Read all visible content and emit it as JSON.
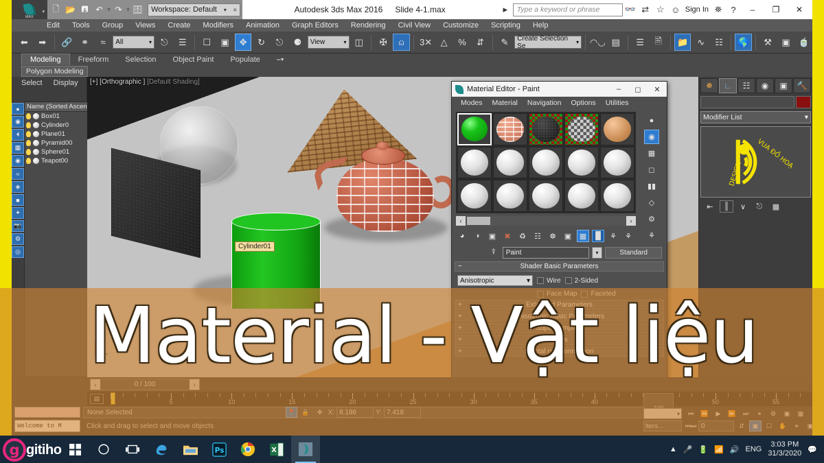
{
  "window": {
    "title": "Autodesk 3ds Max 2016",
    "file": "Slide 4-1.max",
    "workspace": "Workspace: Default",
    "search_placeholder": "Type a keyword or phrase",
    "sign_in": "Sign In",
    "minimize": "–",
    "maximize": "❐",
    "close": "✕",
    "help": "?"
  },
  "menubar": {
    "items": [
      "Edit",
      "Tools",
      "Group",
      "Views",
      "Create",
      "Modifiers",
      "Animation",
      "Graph Editors",
      "Rendering",
      "Civil View",
      "Customize",
      "Scripting",
      "Help"
    ]
  },
  "main_toolbar": {
    "selection_filter": "All",
    "reference_coord": "View",
    "named_selection_sets": "Create Selection Se",
    "icons": [
      "undo-icon",
      "redo-icon",
      "select-link-icon",
      "unlink-icon",
      "bind-space-warp-icon",
      "select-object-icon",
      "select-by-name-icon",
      "rect-select-icon",
      "window-crossing-icon",
      "select-move-icon",
      "select-rotate-icon",
      "select-scale-icon",
      "coordinate-center-icon",
      "snap-toggle-icon",
      "percent-snap-icon",
      "angle-snap-icon",
      "spinner-snap-icon",
      "edit-named-sets-icon",
      "mirror-icon",
      "align-icon",
      "layer-manager-icon",
      "ribbon-icon",
      "curve-editor-icon",
      "schematic-view-icon",
      "material-editor-icon",
      "render-setup-icon",
      "render-frame-icon",
      "render-production-icon"
    ]
  },
  "ribbon": {
    "tabs": [
      "Modeling",
      "Freeform",
      "Selection",
      "Object Paint",
      "Populate"
    ],
    "active_tab": "Modeling",
    "subtab": "Polygon Modeling"
  },
  "scene_explorer": {
    "menu": [
      "Select",
      "Display"
    ],
    "column_header": "Name (Sorted Ascen",
    "objects": [
      "Box01",
      "Cylinder0",
      "Plane01",
      "Pyramid00",
      "Sphere01",
      "Teapot00"
    ]
  },
  "viewport": {
    "label_active": "[+] [Orthographic ]",
    "label_shading": "[Default Shading]",
    "tooltip": "Cylinder01"
  },
  "material_editor": {
    "title": "Material Editor - Paint",
    "menu": [
      "Modes",
      "Material",
      "Navigation",
      "Options",
      "Utilities"
    ],
    "slot_row1": [
      "green-paint",
      "brick",
      "asphalt",
      "checker",
      "tan"
    ],
    "material_name": "Paint",
    "material_type": "Standard",
    "shader": "Anisotropic",
    "checkboxes": [
      "Wire",
      "2-Sided",
      "Face Map",
      "Faceted"
    ],
    "rollouts": [
      "Shader Basic Parameters",
      "Anisotropic Basic Parameters",
      "Extended Parameters",
      "SuperSampling",
      "Maps",
      "mental ray Connection"
    ]
  },
  "command_panel": {
    "tabs": [
      "create-tab",
      "modify-tab",
      "hierarchy-tab",
      "motion-tab",
      "display-tab",
      "utilities-tab"
    ],
    "active_tab_index": 1,
    "modifier_list": "Modifier List",
    "object_name": "",
    "watermark": {
      "line1": "VUA ĐỒ HOẠ",
      "line2": "DESIGN",
      "color": "#f5e300"
    },
    "stack_buttons": [
      "pin-stack-icon",
      "show-end-result-icon",
      "make-unique-icon",
      "remove-modifier-icon",
      "configure-sets-icon"
    ]
  },
  "timeline": {
    "frame_display": "0 / 100",
    "prev_arrow": "‹",
    "next_arrow": "›",
    "ticks": [
      "5",
      "10",
      "15",
      "20",
      "25",
      "30",
      "35",
      "40",
      "45",
      "50",
      "55"
    ],
    "end_label": "100"
  },
  "status_bar": {
    "mini_listener": "",
    "welcome": "Welcome to M",
    "selection": "None Selected",
    "hint": "Click and drag to select and move objects",
    "x_label": "X:",
    "x_value": "8.186",
    "y_label": "Y:",
    "y_value": "7.418",
    "pin_icon": "pin-icon",
    "lock_icon": "lock-icon",
    "absolute_icon": "absolute-mode-icon"
  },
  "animation": {
    "auto_key": "",
    "filters": "lters...",
    "frame_value": "0",
    "controls": [
      "go-to-start",
      "previous-frame",
      "play-animation",
      "next-frame",
      "go-to-end"
    ],
    "tools": [
      "key-mode-icon",
      "time-config-icon",
      "zoom-extents-icon",
      "maximize-viewport-icon",
      "pan-icon",
      "orbit-icon",
      "zoom-region-icon"
    ]
  },
  "overlay": {
    "title": "Material - Vật liệu",
    "band_color": "#d08230"
  },
  "taskbar": {
    "brand": "gitiho",
    "brand_initial": "g",
    "apps": [
      "windows-start-icon",
      "cortana-search-icon",
      "task-view-icon",
      "edge-icon",
      "file-explorer-icon",
      "photoshop-icon",
      "chrome-icon",
      "excel-icon",
      "3dsmax-icon"
    ],
    "tray": [
      "chevron-up-icon",
      "microphone-icon",
      "battery-icon",
      "wifi-icon",
      "volume-icon"
    ],
    "language": "ENG",
    "time": "3:03 PM",
    "date": "31/3/2020",
    "notification_icon": "notification-icon"
  }
}
